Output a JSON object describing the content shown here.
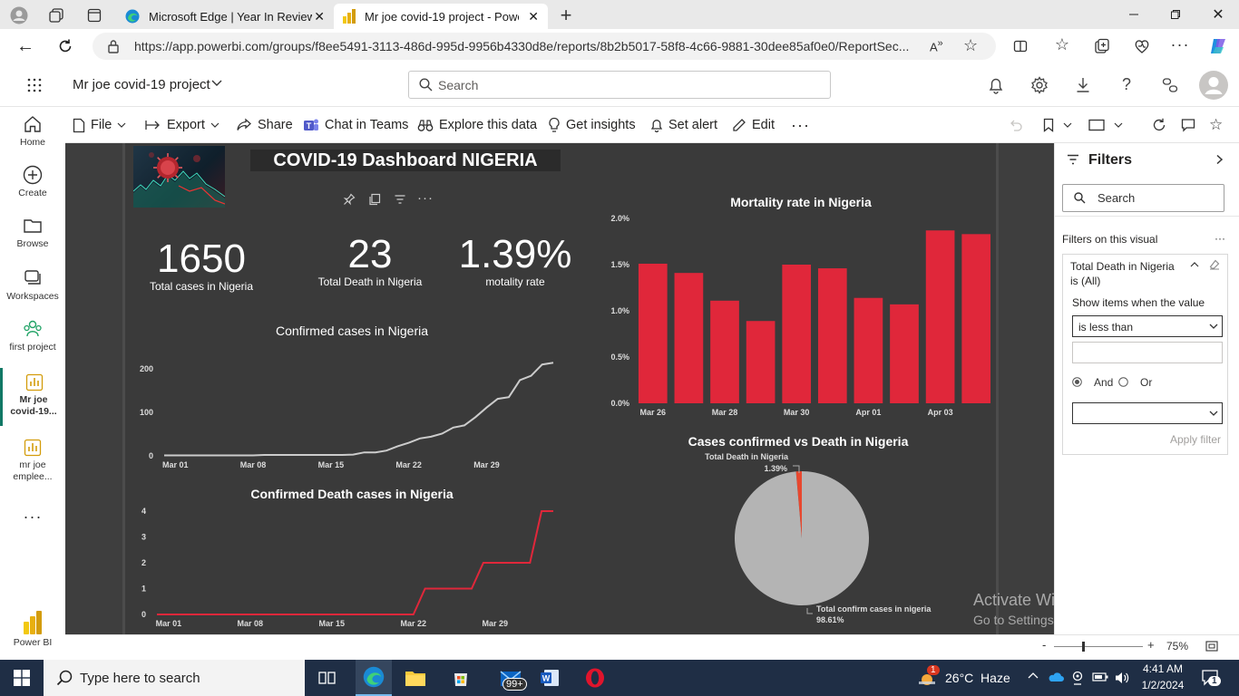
{
  "browser": {
    "tabs": [
      {
        "label": "Microsoft Edge | Year In Review"
      },
      {
        "label": "Mr joe covid-19 project - Power BI"
      }
    ],
    "url": "https://app.powerbi.com/groups/f8ee5491-3113-486d-995d-9956b4330d8e/reports/8b2b5017-58f8-4c66-9881-30dee85af0e0/ReportSec..."
  },
  "pbi": {
    "workspace_title": "Mr joe covid-19 project",
    "search_placeholder": "Search",
    "nav": [
      {
        "label": "Home"
      },
      {
        "label": "Create"
      },
      {
        "label": "Browse"
      },
      {
        "label": "Workspaces"
      },
      {
        "label": "first project"
      },
      {
        "label": "Mr joe covid-19..."
      },
      {
        "label": "mr joe emplee..."
      },
      {
        "label": "Power BI"
      }
    ],
    "toolbar": {
      "file": "File",
      "export": "Export",
      "share": "Share",
      "chat": "Chat in Teams",
      "explore": "Explore this data",
      "insights": "Get insights",
      "alert": "Set alert",
      "edit": "Edit"
    }
  },
  "report": {
    "title": "COVID-19 Dashboard NIGERIA",
    "kpis": [
      {
        "value": "1650",
        "label": "Total cases in Nigeria"
      },
      {
        "value": "23",
        "label": "Total Death in Nigeria"
      },
      {
        "value": "1.39%",
        "label": "motality rate"
      }
    ],
    "colors": {
      "red": "#e0273a",
      "line_gray": "#cccccc",
      "pie_gray": "#b4b4b4",
      "pie_red": "#e8472e"
    }
  },
  "chart_data": [
    {
      "type": "line",
      "title": "Confirmed cases in Nigeria",
      "x_ticks": [
        "Mar 01",
        "Mar 08",
        "Mar 15",
        "Mar 22",
        "Mar 29"
      ],
      "y_ticks": [
        "0",
        "100",
        "200"
      ],
      "ylim": [
        0,
        230
      ],
      "x": [
        "Feb 28",
        "Mar 01",
        "Mar 02",
        "Mar 03",
        "Mar 04",
        "Mar 05",
        "Mar 06",
        "Mar 07",
        "Mar 08",
        "Mar 09",
        "Mar 10",
        "Mar 11",
        "Mar 12",
        "Mar 13",
        "Mar 14",
        "Mar 15",
        "Mar 16",
        "Mar 17",
        "Mar 18",
        "Mar 19",
        "Mar 20",
        "Mar 21",
        "Mar 22",
        "Mar 23",
        "Mar 24",
        "Mar 25",
        "Mar 26",
        "Mar 27",
        "Mar 28",
        "Mar 29",
        "Mar 30",
        "Mar 31",
        "Apr 01",
        "Apr 02",
        "Apr 03",
        "Apr 04"
      ],
      "values": [
        1,
        1,
        1,
        1,
        1,
        1,
        1,
        1,
        1,
        2,
        2,
        2,
        2,
        2,
        2,
        2,
        2,
        3,
        8,
        8,
        12,
        22,
        30,
        40,
        44,
        51,
        65,
        70,
        89,
        111,
        131,
        135,
        174,
        184,
        210,
        214
      ],
      "series_color": "#cccccc"
    },
    {
      "type": "line",
      "title": "Confirmed Death cases in Nigeria",
      "x_ticks": [
        "Mar 01",
        "Mar 08",
        "Mar 15",
        "Mar 22",
        "Mar 29"
      ],
      "y_ticks": [
        "0",
        "1",
        "2",
        "3",
        "4"
      ],
      "ylim": [
        0,
        4
      ],
      "x": [
        "Feb 28",
        "Mar 01",
        "Mar 08",
        "Mar 15",
        "Mar 21",
        "Mar 22",
        "Mar 23",
        "Mar 24",
        "Mar 27",
        "Mar 28",
        "Mar 31",
        "Apr 01",
        "Apr 02",
        "Apr 03"
      ],
      "values": [
        0,
        0,
        0,
        0,
        0,
        0,
        1,
        1,
        1,
        2,
        2,
        2,
        4,
        4
      ],
      "series_color": "#e0273a"
    },
    {
      "type": "bar",
      "title": "Mortality rate in Nigeria",
      "categories": [
        "Mar 26",
        "Mar 27",
        "Mar 28",
        "Mar 29",
        "Mar 30",
        "Mar 31",
        "Apr 01",
        "Apr 02",
        "Apr 03",
        "Apr 04"
      ],
      "x_ticks": [
        "Mar 26",
        "Mar 28",
        "Mar 30",
        "Apr 01",
        "Apr 03"
      ],
      "y_ticks": [
        "0.0%",
        "0.5%",
        "1.0%",
        "1.5%",
        "2.0%"
      ],
      "values": [
        1.51,
        1.41,
        1.11,
        0.89,
        1.5,
        1.46,
        1.14,
        1.07,
        1.87,
        1.83
      ],
      "ylim": [
        0,
        2.0
      ],
      "series_color": "#e0273a"
    },
    {
      "type": "pie",
      "title": "Cases confirmed vs Death in Nigeria",
      "slices": [
        {
          "name": "Total Death in Nigeria",
          "value": 1.39,
          "label": "1.39%",
          "color": "#e8472e"
        },
        {
          "name": "Total confirm cases in nigeria",
          "value": 98.61,
          "label": "98.61%",
          "color": "#b4b4b4"
        }
      ]
    }
  ],
  "filters": {
    "title": "Filters",
    "search_placeholder": "Search",
    "section": "Filters on this visual",
    "card_title": "Total Death in Nigeria",
    "card_sub": "is (All)",
    "show_items": "Show items when the value",
    "condition": "is less than",
    "and_label": "And",
    "or_label": "Or",
    "apply": "Apply filter"
  },
  "status": {
    "zoom": "75%"
  },
  "windows": {
    "activate_title": "Activate Windows",
    "activate_sub": "Go to Settings to activate Windows.",
    "search_placeholder": "Type here to search",
    "weather": "26°C  Haze",
    "time": "4:41 AM",
    "date": "1/2/2024",
    "mail_badge": "99+",
    "notif_count": "1",
    "weather_badge": "1"
  }
}
